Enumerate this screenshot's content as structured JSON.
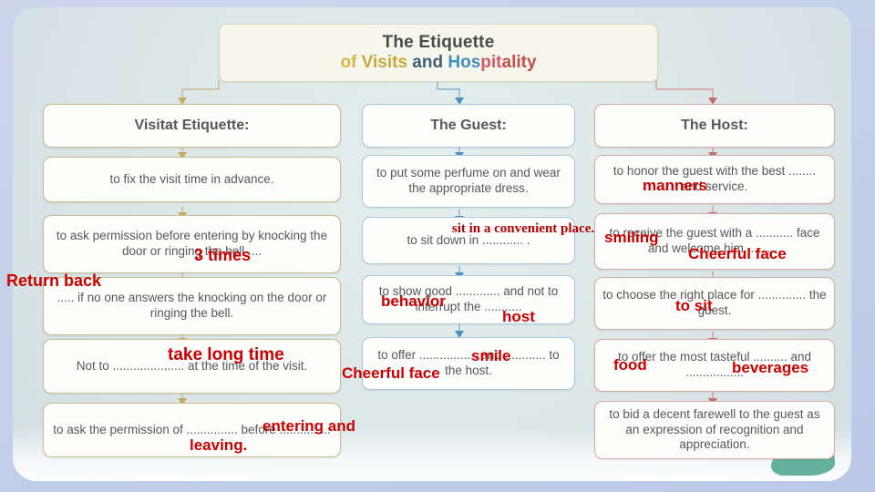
{
  "title": {
    "line1": "The Etiquette",
    "of": "of ",
    "visits": "Visits",
    "and": " and ",
    "hos": "Hos",
    "pit": "pit",
    "ality": "ality"
  },
  "columns": {
    "left": {
      "header": "Visitat Etiquette:",
      "accent": "#cbb98f",
      "items": [
        "to fix the visit time in advance.",
        "to ask permission before entering by knocking the door or ringing the bell ....",
        "..... if no one answers the knocking on the door or ringing the bell.",
        "Not to ..................... at the time of the visit.",
        "to ask the permission of ............... before ..............."
      ]
    },
    "mid": {
      "header": "The Guest:",
      "accent": "#a9c9dd",
      "items": [
        "to put some perfume on and wear the appropriate dress.",
        "to sit down in ............ .",
        "to show good ............. and not to interrupt the ...........",
        "to offer ................. and ............ to the host."
      ]
    },
    "right": {
      "header": "The Host:",
      "accent": "#d9a9a5",
      "items": [
        "to honor the guest with the best ........ and service.",
        "to receive the guest with a ........... face and welcome him ..........",
        "to choose the right place for .............. the guest.",
        "to offer the most tasteful .......... and .................",
        "to bid a decent farewell to the guest as an expression of recognition and appreciation."
      ]
    }
  },
  "annotations": {
    "ann_three_times": "3 times",
    "ann_return_back": "Return back",
    "ann_take_long_time": "take long time",
    "ann_entering_and": "entering and",
    "ann_leaving": "leaving.",
    "ann_sit_convenient": "sit in a convenient place.",
    "ann_behavior": "behavior",
    "ann_host": "host",
    "ann_smile": "smile",
    "ann_cheerful_face_guest": "Cheerful face",
    "ann_manners": "manners",
    "ann_smiling": "smiling",
    "ann_cheerful_face_host": "Cheerful face",
    "ann_to_sit": "to sit",
    "ann_food": "food",
    "ann_beverages": "beverages"
  },
  "colors": {
    "annotation_red": "#cc0000",
    "left_accent": "#cbb98f",
    "mid_accent": "#4f9bc4",
    "right_accent": "#cf7f7a",
    "page_background": "#c9d3ea",
    "card_background": "#dfe9e9",
    "title_background": "#f7f6ec"
  }
}
